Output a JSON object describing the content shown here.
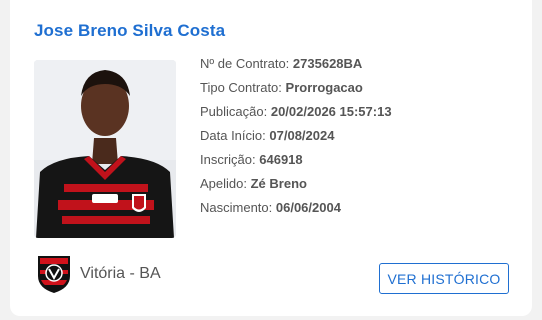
{
  "player": {
    "name": "Jose Breno Silva Costa"
  },
  "fields": [
    {
      "label": "Nº de Contrato:",
      "value": "2735628BA"
    },
    {
      "label": "Tipo Contrato:",
      "value": "Prorrogacao"
    },
    {
      "label": "Publicação:",
      "value": "20/02/2026 15:57:13"
    },
    {
      "label": "Data Início:",
      "value": "07/08/2024"
    },
    {
      "label": "Inscrição:",
      "value": "646918"
    },
    {
      "label": "Apelido:",
      "value": "Zé Breno"
    },
    {
      "label": "Nascimento:",
      "value": "06/06/2004"
    }
  ],
  "club": {
    "name": "Vitória - BA",
    "crest_icon": "club-crest-icon",
    "colors": {
      "red": "#d0121b",
      "black": "#111111"
    }
  },
  "actions": {
    "history_label": "VER HISTÓRICO"
  },
  "colors": {
    "accent": "#1f6fd1",
    "text": "#555555",
    "background": "#f2f2f2",
    "card": "#ffffff"
  }
}
